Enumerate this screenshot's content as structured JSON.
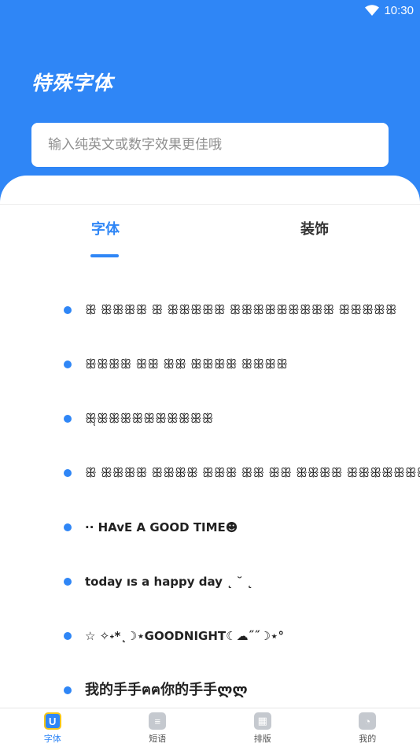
{
  "status_bar": {
    "time": "10:30"
  },
  "header": {
    "title": "特殊字体",
    "search_placeholder": "输入纯英文或数字效果更佳哦",
    "search_value": ""
  },
  "tabs": [
    {
      "label": "字体",
      "active": true
    },
    {
      "label": "装饰",
      "active": false
    }
  ],
  "font_samples": [
    "ꕥ ꕥꕥꕥꕥ ꕥ ꕥꕥꕥꕥꕥ ꕥꕥꕥꕥꕥꕥꕥꕥꕥ ꕥꕥꕥꕥꕥ",
    " ꕥꕥꕥꕥ ꕥꕥ ꕥꕥ ꕥꕥꕥꕥ ꕥꕥꕥꕥ",
    "ꕥ̜ꕥꕥꕥꕥꕥꕥꕥꕥꕥꕥ",
    "ꕥ ꕥꕥꕥꕥ ꕥꕥꕥꕥ ꕥꕥꕥ ꕥꕥ ꕥꕥ ꕥꕥꕥꕥ ꕥꕥꕥꕥꕥꕥꕥ",
    "·· HAvE A GOOD TIME☻",
    "today ıs a happy day ˛ ˘ ˛",
    "☆ ✧˖*˛☽⋆GOODNIGHT☾☁˝˝☽⋆°",
    "我的手手ฅฅ你的手手ლლ"
  ],
  "bottom_nav": [
    {
      "label": "字体",
      "icon": "font-icon",
      "glyph": "U",
      "active": true
    },
    {
      "label": "短语",
      "icon": "phrase-icon",
      "glyph": "≡",
      "active": false
    },
    {
      "label": "排版",
      "icon": "layout-icon",
      "glyph": "▦",
      "active": false
    },
    {
      "label": "我的",
      "icon": "profile-icon",
      "glyph": "◔",
      "active": false
    }
  ],
  "colors": {
    "primary": "#2f86f6",
    "text": "#222222",
    "nav_icon_inactive": "#c5c9cf"
  }
}
